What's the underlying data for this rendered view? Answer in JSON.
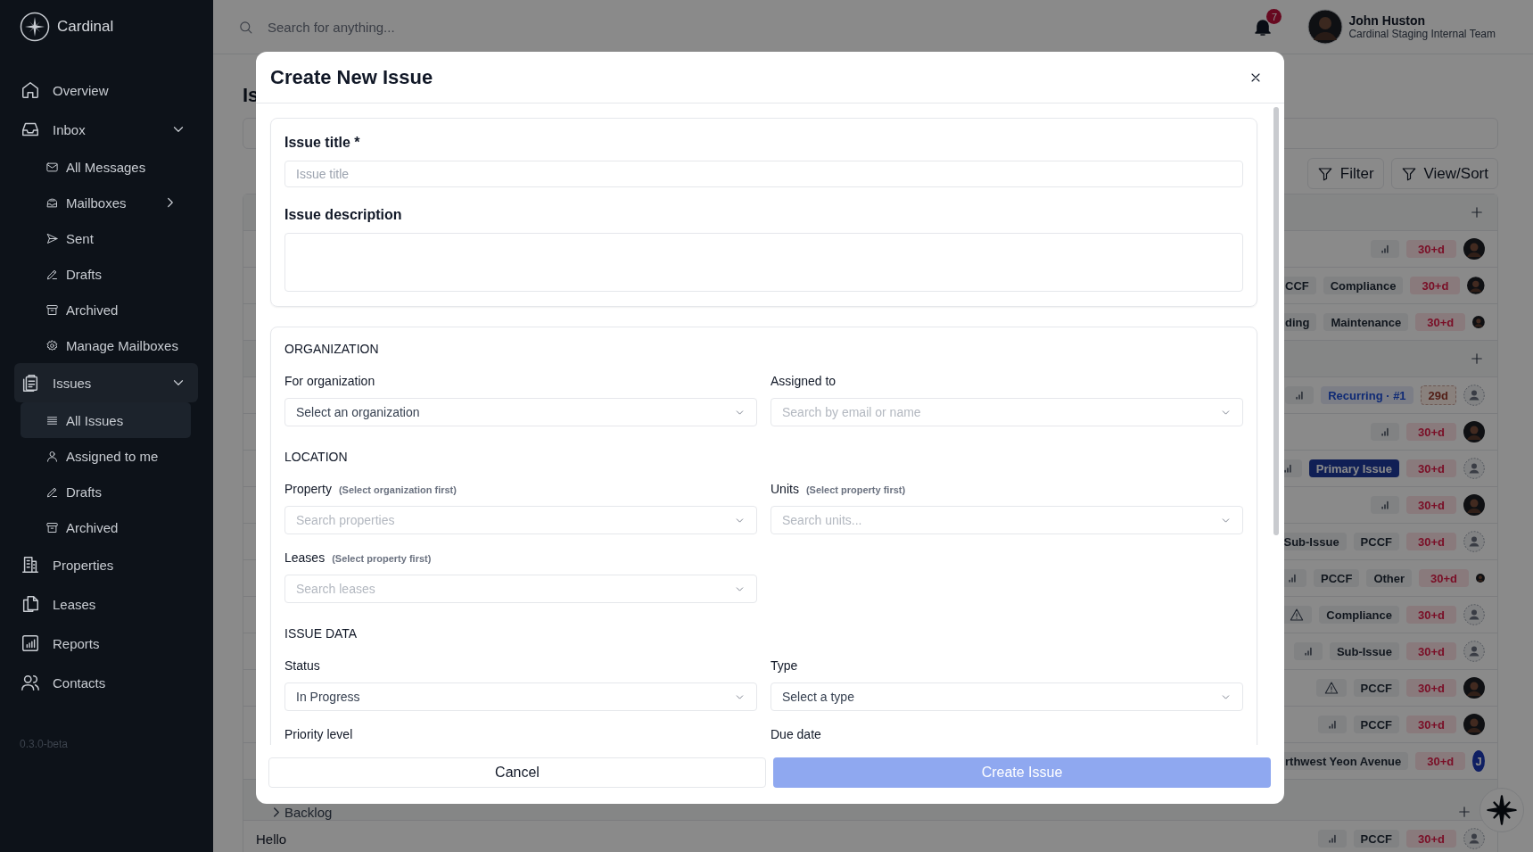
{
  "sidebar": {
    "brand": "Cardinal",
    "items": [
      {
        "label": "Overview",
        "selected": false
      },
      {
        "label": "Inbox",
        "selected": false,
        "expanded": true,
        "children": [
          {
            "label": "All Messages",
            "selected": false
          },
          {
            "label": "Mailboxes",
            "selected": false,
            "expanded": false
          },
          {
            "label": "Sent",
            "selected": false
          },
          {
            "label": "Drafts",
            "selected": false
          },
          {
            "label": "Archived",
            "selected": false
          },
          {
            "label": "Manage Mailboxes",
            "selected": false
          }
        ]
      },
      {
        "label": "Issues",
        "selected": true,
        "expanded": true,
        "children": [
          {
            "label": "All Issues",
            "selected": true
          },
          {
            "label": "Assigned to me",
            "selected": false
          },
          {
            "label": "Drafts",
            "selected": false
          },
          {
            "label": "Archived",
            "selected": false
          }
        ]
      },
      {
        "label": "Properties",
        "selected": false
      },
      {
        "label": "Leases",
        "selected": false
      },
      {
        "label": "Reports",
        "selected": false
      },
      {
        "label": "Contacts",
        "selected": false
      }
    ],
    "version": "0.3.0-beta"
  },
  "topbar": {
    "search_placeholder": "Search for anything...",
    "notification_count": "7",
    "user": {
      "name": "John Huston",
      "team": "Cardinal Staging Internal Team"
    }
  },
  "page": {
    "title": "Is",
    "buttons": [
      "Filter",
      "View/Sort"
    ],
    "rows": [
      {
        "kind": "group"
      },
      {
        "kind": "issue",
        "tags": [
          {
            "kind": "priority"
          },
          {
            "kind": "overdue",
            "text": "30+d"
          }
        ],
        "avatar": {
          "kind": "photo"
        }
      },
      {
        "kind": "issue",
        "tags": [
          {
            "kind": "cut",
            "text": "CCF"
          },
          {
            "kind": "label",
            "text": "Compliance"
          },
          {
            "kind": "overdue",
            "text": "30+d"
          }
        ],
        "avatar": {
          "kind": "photo"
        }
      },
      {
        "kind": "issue",
        "tags": [
          {
            "kind": "cut",
            "text": "ding"
          },
          {
            "kind": "label",
            "text": "Maintenance"
          },
          {
            "kind": "overdue",
            "text": "30+d"
          }
        ],
        "avatar": {
          "kind": "photo"
        }
      },
      {
        "kind": "group"
      },
      {
        "kind": "issue",
        "tags": [
          {
            "kind": "priority"
          },
          {
            "kind": "recurring",
            "text": "Recurring · #1"
          },
          {
            "kind": "due",
            "text": "29d"
          }
        ],
        "avatar": {
          "kind": "none"
        }
      },
      {
        "kind": "issue",
        "tags": [
          {
            "kind": "priority"
          },
          {
            "kind": "overdue",
            "text": "30+d"
          }
        ],
        "avatar": {
          "kind": "photo"
        }
      },
      {
        "kind": "issue",
        "tags": [
          {
            "kind": "priority"
          },
          {
            "kind": "primary",
            "text": "Primary Issue"
          },
          {
            "kind": "overdue",
            "text": "30+d"
          }
        ],
        "avatar": {
          "kind": "none"
        }
      },
      {
        "kind": "issue",
        "tags": [
          {
            "kind": "priority"
          },
          {
            "kind": "overdue",
            "text": "30+d"
          }
        ],
        "avatar": {
          "kind": "photo"
        }
      },
      {
        "kind": "issue",
        "tags": [
          {
            "kind": "label",
            "text": "Sub-Issue"
          },
          {
            "kind": "label",
            "text": "PCCF"
          },
          {
            "kind": "overdue",
            "text": "30+d"
          }
        ],
        "avatar": {
          "kind": "none"
        }
      },
      {
        "kind": "issue",
        "tags": [
          {
            "kind": "cut_priority"
          },
          {
            "kind": "label",
            "text": "PCCF"
          },
          {
            "kind": "label",
            "text": "Other"
          },
          {
            "kind": "overdue",
            "text": "30+d"
          }
        ],
        "avatar": {
          "kind": "photo"
        }
      },
      {
        "kind": "issue",
        "tags": [
          {
            "kind": "warning"
          },
          {
            "kind": "label",
            "text": "Compliance"
          },
          {
            "kind": "overdue",
            "text": "30+d"
          }
        ],
        "avatar": {
          "kind": "none"
        }
      },
      {
        "kind": "issue",
        "tags": [
          {
            "kind": "priority"
          },
          {
            "kind": "label",
            "text": "Sub-Issue"
          },
          {
            "kind": "overdue",
            "text": "30+d"
          }
        ],
        "avatar": {
          "kind": "none"
        }
      },
      {
        "kind": "issue",
        "tags": [
          {
            "kind": "warning"
          },
          {
            "kind": "label",
            "text": "PCCF"
          },
          {
            "kind": "overdue",
            "text": "30+d"
          }
        ],
        "avatar": {
          "kind": "photo"
        }
      },
      {
        "kind": "issue",
        "tags": [
          {
            "kind": "priority"
          },
          {
            "kind": "label",
            "text": "PCCF"
          },
          {
            "kind": "overdue",
            "text": "30+d"
          }
        ],
        "avatar": {
          "kind": "photo"
        }
      },
      {
        "kind": "issue",
        "tags": [
          {
            "kind": "cut",
            "text": "rthwest Yeon Avenue"
          },
          {
            "kind": "overdue",
            "text": "30+d"
          }
        ],
        "avatar": {
          "kind": "initial",
          "text": "J"
        }
      },
      {
        "kind": "group",
        "label": "Backlog"
      },
      {
        "kind": "issue",
        "title": "Hello",
        "tags": [
          {
            "kind": "priority"
          },
          {
            "kind": "label",
            "text": "PCCF"
          },
          {
            "kind": "overdue",
            "text": "30+d"
          }
        ],
        "avatar": {
          "kind": "none"
        }
      }
    ]
  },
  "modal": {
    "title": "Create New Issue",
    "basics": [
      {
        "kind": "text",
        "label": "Issue title *",
        "placeholder": "Issue title"
      },
      {
        "kind": "textarea",
        "label": "Issue description"
      }
    ],
    "sections": [
      {
        "heading": "ORGANIZATION",
        "fields": [
          {
            "kind": "select",
            "label": "For organization",
            "value": "Select an organization"
          },
          {
            "kind": "select",
            "label": "Assigned to",
            "placeholder": "Search by email or name"
          }
        ]
      },
      {
        "heading": "LOCATION",
        "fields": [
          {
            "kind": "select",
            "label": "Property",
            "hint": "(Select organization first)",
            "placeholder": "Search properties"
          },
          {
            "kind": "select",
            "label": "Units",
            "hint": "(Select property first)",
            "placeholder": "Search units..."
          },
          {
            "kind": "select",
            "label": "Leases",
            "hint": "(Select property first)",
            "placeholder": "Search leases"
          }
        ]
      },
      {
        "heading": "ISSUE DATA",
        "fields": [
          {
            "kind": "select",
            "label": "Status",
            "value": "In Progress"
          },
          {
            "kind": "select",
            "label": "Type",
            "value": "Select a type"
          },
          {
            "label": "Priority level"
          },
          {
            "label": "Due date"
          }
        ]
      }
    ],
    "buttons": [
      {
        "kind": "secondary",
        "label": "Cancel",
        "disabled": false
      },
      {
        "kind": "primary",
        "label": "Create Issue",
        "disabled": true
      }
    ]
  }
}
